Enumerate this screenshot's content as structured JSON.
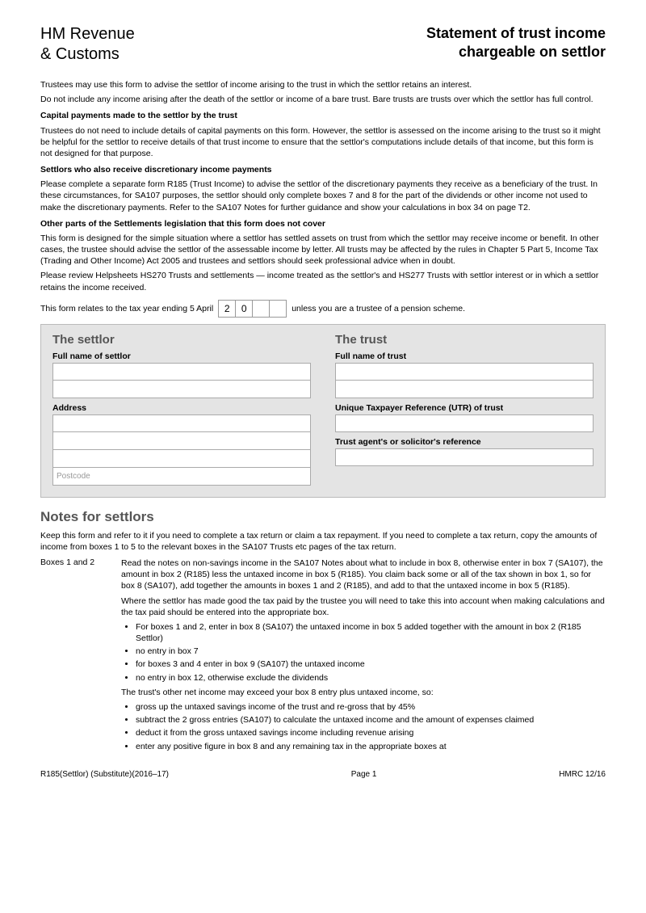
{
  "header": {
    "org_line1": "HM Revenue",
    "org_line2": "& Customs",
    "title_line1": "Statement of trust income",
    "title_line2": "chargeable on settlor"
  },
  "intro": {
    "p1": "Trustees may use this form to advise the settlor of income arising to the trust in which the settlor retains an interest.",
    "p2": "Do not include any income arising after the death of the settlor or income of a bare trust. Bare trusts are trusts over which the settlor has full control.",
    "sub1": "Capital payments made to the settlor by the trust",
    "p3": "Trustees do not need to include details of capital payments on this form. However, the settlor is assessed on the income arising to the trust so it might be helpful for the settlor to receive details of that trust income to ensure that the settlor's computations include details of that income, but this form is not designed for that purpose.",
    "sub2": "Settlors who also receive discretionary income payments",
    "p4": "Please complete a separate form R185 (Trust Income) to advise the settlor of the discretionary payments they receive as a beneficiary of the trust. In these circumstances, for SA107 purposes, the settlor should only complete boxes 7 and 8 for the part of the dividends or other income not used to make the discretionary payments. Refer to the SA107 Notes for further guidance and show your calculations in box 34 on page T2.",
    "sub3": "Other parts of the Settlements legislation that this form does not cover",
    "p5": "This form is designed for the simple situation where a settlor has settled assets on trust from which the settlor may receive income or benefit. In other cases, the trustee should advise the settlor of the assessable income by letter. All trusts may be affected by the rules in Chapter 5 Part 5, Income Tax (Trading and Other Income) Act 2005 and trustees and settlors should seek professional advice when in doubt.",
    "p6": "Please review Helpsheets HS270 Trusts and settlements — income treated as the settlor's and HS277 Trusts with settlor interest or in which a settlor retains the income received.",
    "year_pre": "This form relates to the tax year ending 5 April",
    "year_fixed1": "2",
    "year_fixed2": "0",
    "year_post": "unless you are a trustee of a pension scheme."
  },
  "form": {
    "settlor_heading": "The settlor",
    "settlor_name_label": "Full name of settlor",
    "address_label": "Address",
    "postcode_placeholder": "Postcode",
    "trust_heading": "The trust",
    "trust_name_label": "Full name of trust",
    "utr_label": "Unique Taxpayer Reference (UTR) of trust",
    "agent_label": "Trust agent's or solicitor's reference"
  },
  "notes": {
    "heading": "Notes for settlors",
    "intro": "Keep this form and refer to it if you need to complete a tax return or claim a tax repayment. If you need to complete a tax return, copy the amounts of income from boxes 1 to 5 to the relevant boxes in the SA107 Trusts etc pages of the tax return.",
    "box12_label": "Boxes 1 and 2",
    "box12_p1": "Read the notes on non-savings income in the SA107 Notes about what to include in box 8, otherwise enter in box 7 (SA107), the amount in box 2 (R185) less the untaxed income in box 5 (R185). You claim back some or all of the tax shown in box 1, so for box 8 (SA107), add together the amounts in boxes 1 and 2 (R185), and add to that the untaxed income in box 5 (R185).",
    "box12_p2": "Where the settlor has made good the tax paid by the trustee you will need to take this into account when making calculations and the tax paid should be entered into the appropriate box.",
    "box12_bullets": [
      "For boxes 1 and 2, enter in box 8 (SA107) the untaxed income in box 5 added together with the amount in box 2 (R185 Settlor)",
      "no entry in box 7",
      "for boxes 3 and 4 enter in box 9 (SA107) the untaxed income",
      "no entry in box 12, otherwise exclude the dividends"
    ],
    "box12_p3": "The trust's other net income may exceed your box 8 entry plus untaxed income, so:",
    "box12_bullets2": [
      "gross up the untaxed savings income of the trust and re-gross that by 45%",
      "subtract the 2 gross entries (SA107) to calculate the untaxed income and the amount of expenses claimed",
      "deduct it from the gross untaxed savings income including revenue arising",
      "enter any positive figure in box 8 and any remaining tax in the appropriate boxes at"
    ]
  },
  "footer": {
    "left": "R185(Settlor) (Substitute)(2016–17)",
    "center": "Page 1",
    "right": "HMRC 12/16"
  }
}
